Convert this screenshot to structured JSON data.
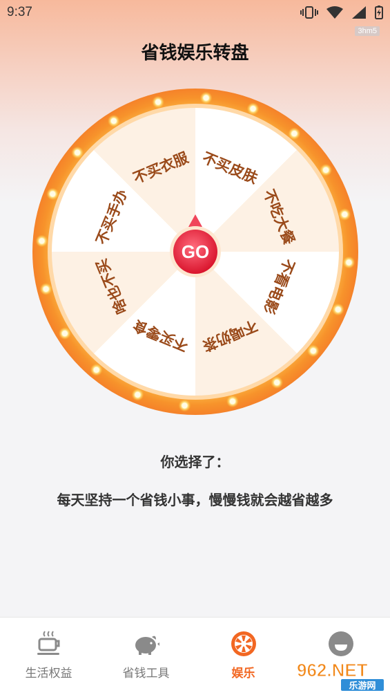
{
  "status_bar": {
    "time": "9:37",
    "build_tag": "3hm5"
  },
  "header": {
    "title": "省钱娱乐转盘"
  },
  "wheel": {
    "go_label": "GO",
    "segments": [
      "不买皮肤",
      "不吃大餐",
      "不看电影",
      "不喝奶茶",
      "不买零食",
      "啥也不买",
      "不买手办",
      "不买衣服"
    ]
  },
  "result": {
    "label": "你选择了：",
    "text": "每天坚持一个省钱小事，慢慢钱就会越省越多"
  },
  "tabbar": {
    "tabs": [
      {
        "label": "生活权益",
        "icon": "coffee-cup-icon"
      },
      {
        "label": "省钱工具",
        "icon": "piggy-bank-icon"
      },
      {
        "label": "娱乐",
        "icon": "wheel-icon",
        "active": true
      },
      {
        "label": "",
        "icon": "smile-face-icon"
      }
    ]
  },
  "watermark": {
    "brand": "962.NET",
    "sub": "乐游网"
  },
  "colors": {
    "accent": "#f26722",
    "wheel_rim": "#f7932b",
    "segment_light": "#ffffff",
    "segment_alt": "#fdf1e4",
    "go_button": "#e8243d",
    "text_segment": "#9a4a1a"
  }
}
